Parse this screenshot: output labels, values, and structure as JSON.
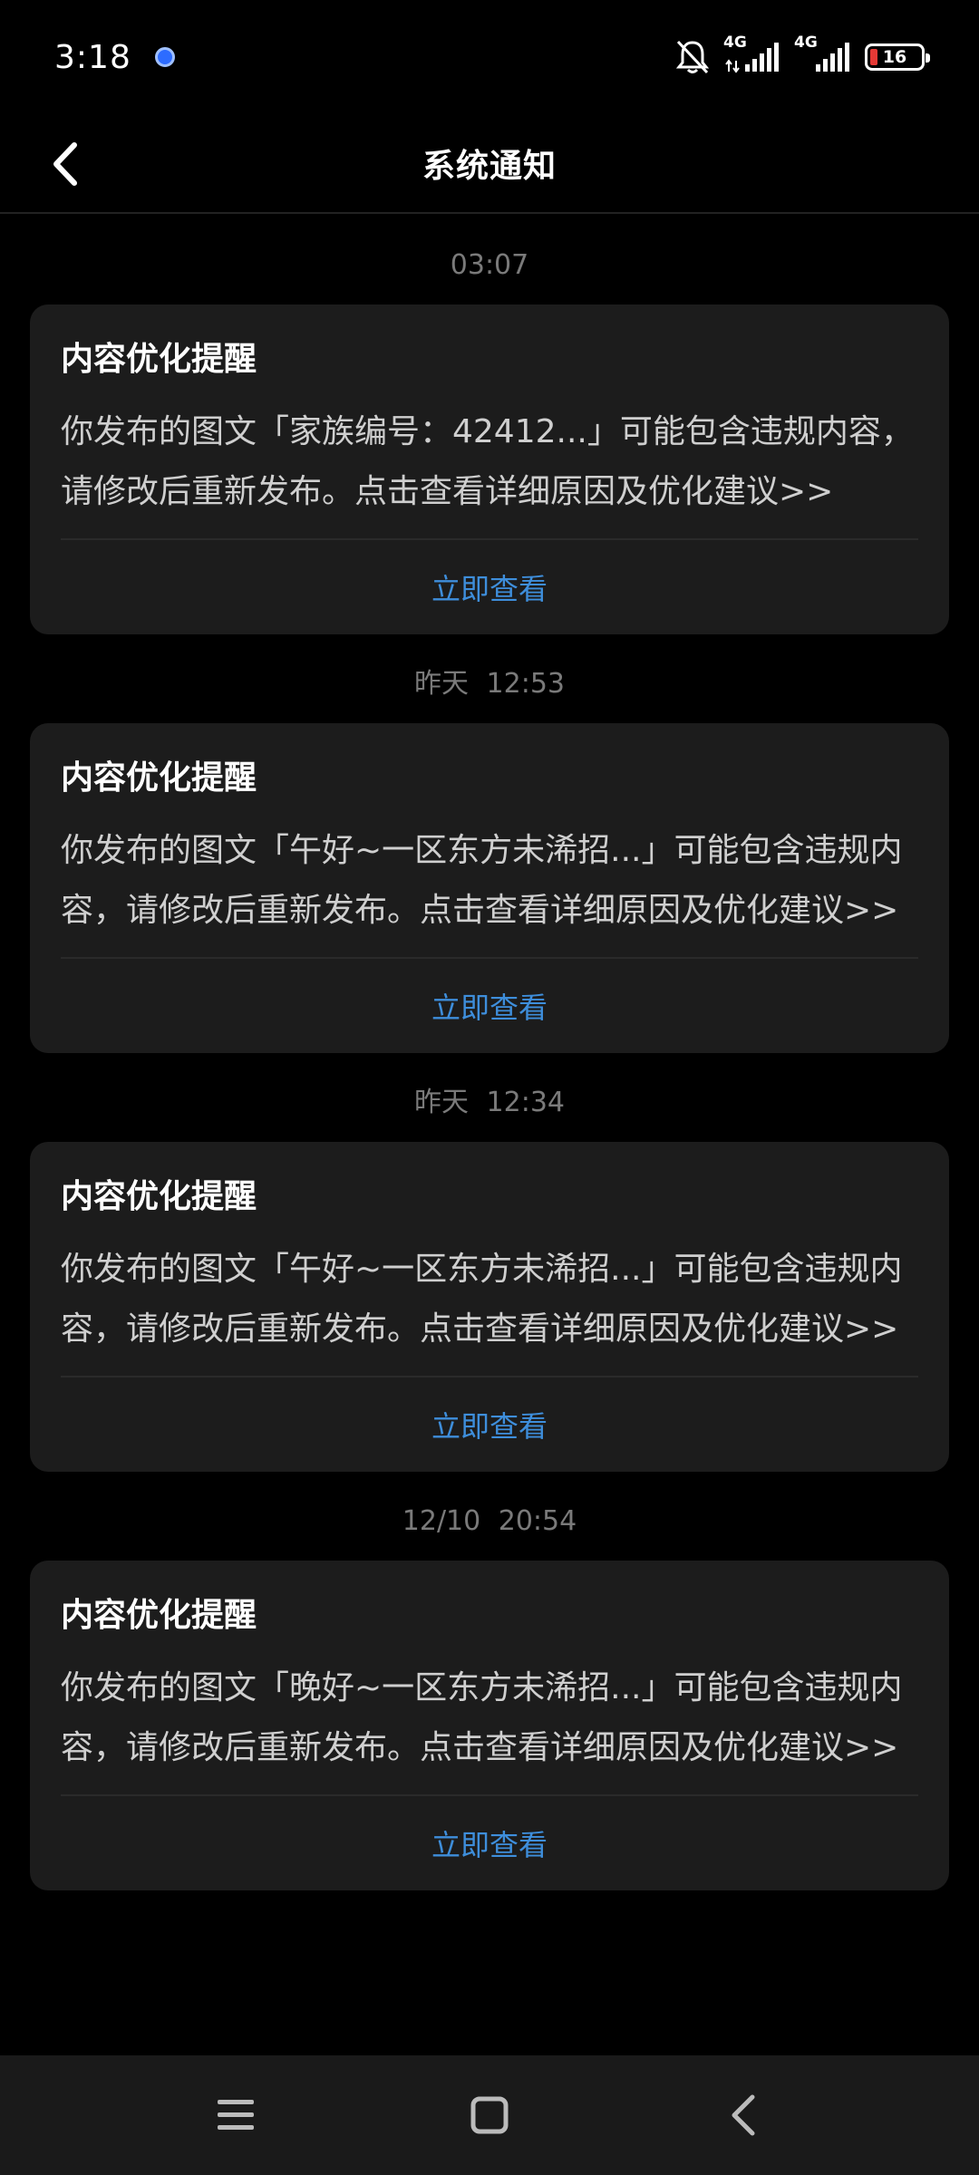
{
  "status_bar": {
    "time": "3:18",
    "network_1": "4G",
    "network_2": "4G",
    "battery": "16",
    "icons": [
      "bell-off-icon",
      "signal-icon",
      "battery-icon"
    ]
  },
  "header": {
    "title": "系统通知",
    "back_icon": "chevron-left-icon"
  },
  "notifications": [
    {
      "timestamp": "03:07",
      "title": "内容优化提醒",
      "body": "你发布的图文「家族编号：42412...」可能包含违规内容，请修改后重新发布。点击查看详细原因及优化建议>>",
      "action": "立即查看"
    },
    {
      "timestamp": "昨天 12:53",
      "title": "内容优化提醒",
      "body": "你发布的图文「午好~一区东方未浠招...」可能包含违规内容，请修改后重新发布。点击查看详细原因及优化建议>>",
      "action": "立即查看"
    },
    {
      "timestamp": "昨天 12:34",
      "title": "内容优化提醒",
      "body": "你发布的图文「午好~一区东方未浠招...」可能包含违规内容，请修改后重新发布。点击查看详细原因及优化建议>>",
      "action": "立即查看"
    },
    {
      "timestamp": "12/10 20:54",
      "title": "内容优化提醒",
      "body": "你发布的图文「晚好~一区东方未浠招...」可能包含违规内容，请修改后重新发布。点击查看详细原因及优化建议>>",
      "action": "立即查看"
    }
  ],
  "nav_bar": {
    "icons": [
      "menu-icon",
      "home-square-icon",
      "back-chevron-icon"
    ]
  },
  "colors": {
    "background": "#000000",
    "card": "#1c1c1c",
    "accent": "#3e8edb",
    "muted": "#7a7a7a"
  }
}
